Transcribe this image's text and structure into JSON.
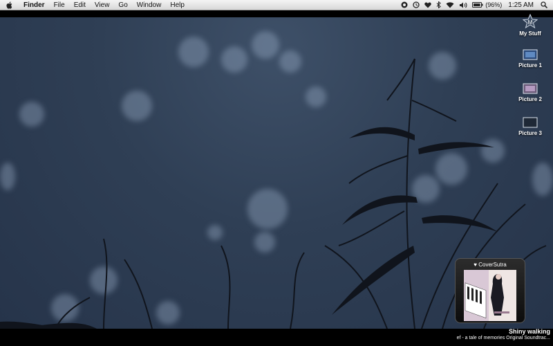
{
  "menubar": {
    "app_name": "Finder",
    "items": [
      "File",
      "Edit",
      "View",
      "Go",
      "Window",
      "Help"
    ],
    "battery_text": "(96%)",
    "clock": "1:25 AM"
  },
  "desktop_icons": [
    {
      "label": "My Stuff"
    },
    {
      "label": "Picture 1"
    },
    {
      "label": "Picture 2"
    },
    {
      "label": "Picture 3"
    }
  ],
  "coversutra": {
    "title": "CoverSutra",
    "track": "Shiny walking",
    "album": "ef - a tale of memories Original Soundtrac..."
  },
  "colors": {
    "desktop_bg": "#2f3f55",
    "menubar_bg": "#e6e6e6",
    "widget_bg": "#1a1a1a"
  }
}
